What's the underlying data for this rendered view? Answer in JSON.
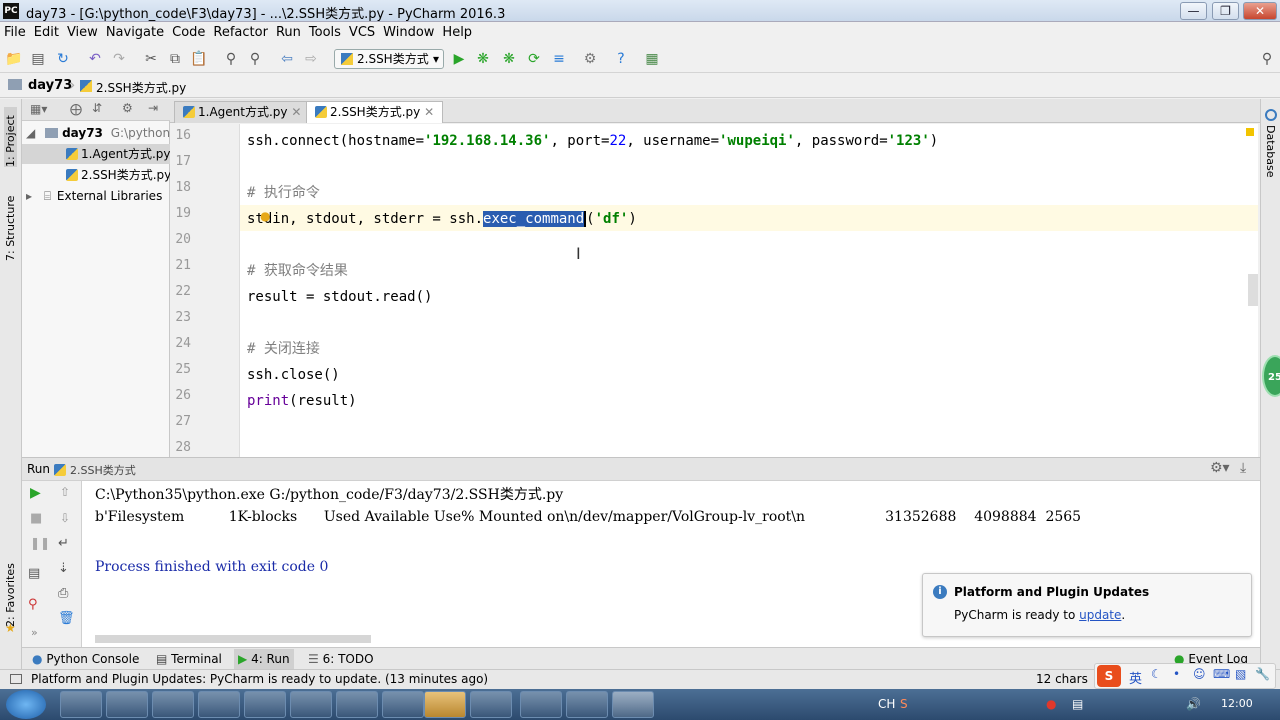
{
  "window": {
    "title": "day73 - [G:\\python_code\\F3\\day73] - ...\\2.SSH类方式.py - PyCharm 2016.3",
    "app_icon": "PC"
  },
  "menu": [
    "File",
    "Edit",
    "View",
    "Navigate",
    "Code",
    "Refactor",
    "Run",
    "Tools",
    "VCS",
    "Window",
    "Help"
  ],
  "toolbar": {
    "run_config": "2.SSH类方式"
  },
  "breadcrumb": {
    "project": "day73",
    "file": "2.SSH类方式.py"
  },
  "left_strip": {
    "project": "1: Project",
    "structure": "7: Structure",
    "favorites": "2: Favorites"
  },
  "right_strip": {
    "database": "Database"
  },
  "project_tree": {
    "root_name": "day73",
    "root_path": "G:\\python_",
    "items": [
      "1.Agent方式.py",
      "2.SSH类方式.py"
    ],
    "external": "External Libraries"
  },
  "editor_tabs": [
    {
      "label": "1.Agent方式.py"
    },
    {
      "label": "2.SSH类方式.py"
    }
  ],
  "line_numbers": [
    "16",
    "17",
    "18",
    "19",
    "20",
    "21",
    "22",
    "23",
    "24",
    "25",
    "26",
    "27",
    "28"
  ],
  "code": {
    "l16a": "ssh.connect(hostname=",
    "l16b": "'192.168.14.36'",
    "l16c": ", port=",
    "l16d": "22",
    "l16e": ", username=",
    "l16f": "'wupeiqi'",
    "l16g": ", password=",
    "l16h": "'123'",
    "l16i": ")",
    "l18": "# 执行命令",
    "l19a": "stdin, stdout, stderr = ssh.",
    "l19b": "exec_command",
    "l19c": "(",
    "l19d": "'df'",
    "l19e": ")",
    "l21": "# 获取命令结果",
    "l22": "result = stdout.read()",
    "l24": "# 关闭连接",
    "l25": "ssh.close()",
    "l26a": "print",
    "l26b": "(result)"
  },
  "run_panel": {
    "label": "Run",
    "config": "2.SSH类方式"
  },
  "console": {
    "line1": "C:\\Python35\\python.exe G:/python_code/F3/day73/2.SSH类方式.py",
    "line2": "b'Filesystem          1K-blocks      Used Available Use% Mounted on\\n/dev/mapper/VolGroup-lv_root\\n                  31352688    4098884  2565",
    "line4": "Process finished with exit code 0"
  },
  "notification": {
    "title": "Platform and Plugin Updates",
    "text": "PyCharm is ready to ",
    "link": "update",
    "suffix": "."
  },
  "bottom_tabs": {
    "python_console": "Python Console",
    "terminal": "Terminal",
    "run": "4: Run",
    "todo": "6: TODO",
    "event_log": "Event Log"
  },
  "status": {
    "message": "Platform and Plugin Updates: PyCharm is ready to update. (13 minutes ago)",
    "chars": "12 chars"
  },
  "taskbar": {
    "time": "12:00",
    "lang": "CH",
    "ime": "英"
  },
  "badge": {
    "text": "25"
  },
  "colors": {
    "selection": "#2a5db0",
    "string": "#008000",
    "number": "#0000ff",
    "comment": "#808080",
    "current_line": "#fffae3"
  }
}
